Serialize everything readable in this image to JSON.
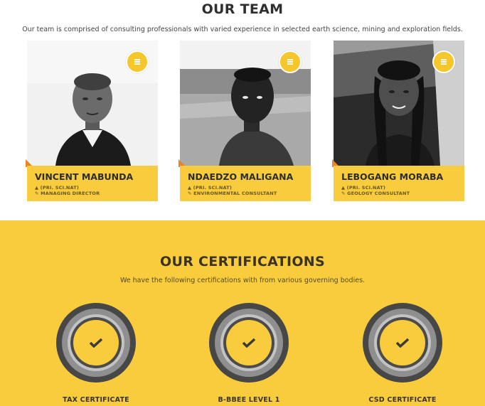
{
  "team": {
    "title": "OUR TEAM",
    "subtitle": "Our team is comprised of consulting professionals with varied experience in selected earth science, mining and exploration fields.",
    "members": [
      {
        "name": "VINCENT MABUNDA",
        "credential": "(PRI. SCI.NAT)",
        "role": "MANAGING DIRECTOR"
      },
      {
        "name": "NDAEDZO MALIGANA",
        "credential": "(PRI. SCI.NAT)",
        "role": "ENVIRONMENTAL CONSULTANT"
      },
      {
        "name": "LEBOGANG MORABA",
        "credential": "(PRI. SCI.NAT)",
        "role": "GEOLOGY CONSULTANT"
      }
    ]
  },
  "certifications": {
    "title": "OUR CERTIFICATIONS",
    "subtitle": "We have the following certifications with from various governing bodies.",
    "items": [
      {
        "label": "TAX CERTIFICATE",
        "icon": "checkmark-icon"
      },
      {
        "label": "B-BBEE LEVEL 1",
        "icon": "checkmark-icon"
      },
      {
        "label": "CSD CERTIFICATE",
        "icon": "checkmark-icon"
      }
    ]
  },
  "colors": {
    "accent": "#f8cc3c",
    "accent_dark": "#f6c72a",
    "corner": "#e8842a",
    "heading": "#2f2f2f"
  },
  "icons": {
    "menu": "menu-icon",
    "credential": "graduation-cap-icon",
    "role": "wrench-icon",
    "check": "checkmark-icon"
  }
}
